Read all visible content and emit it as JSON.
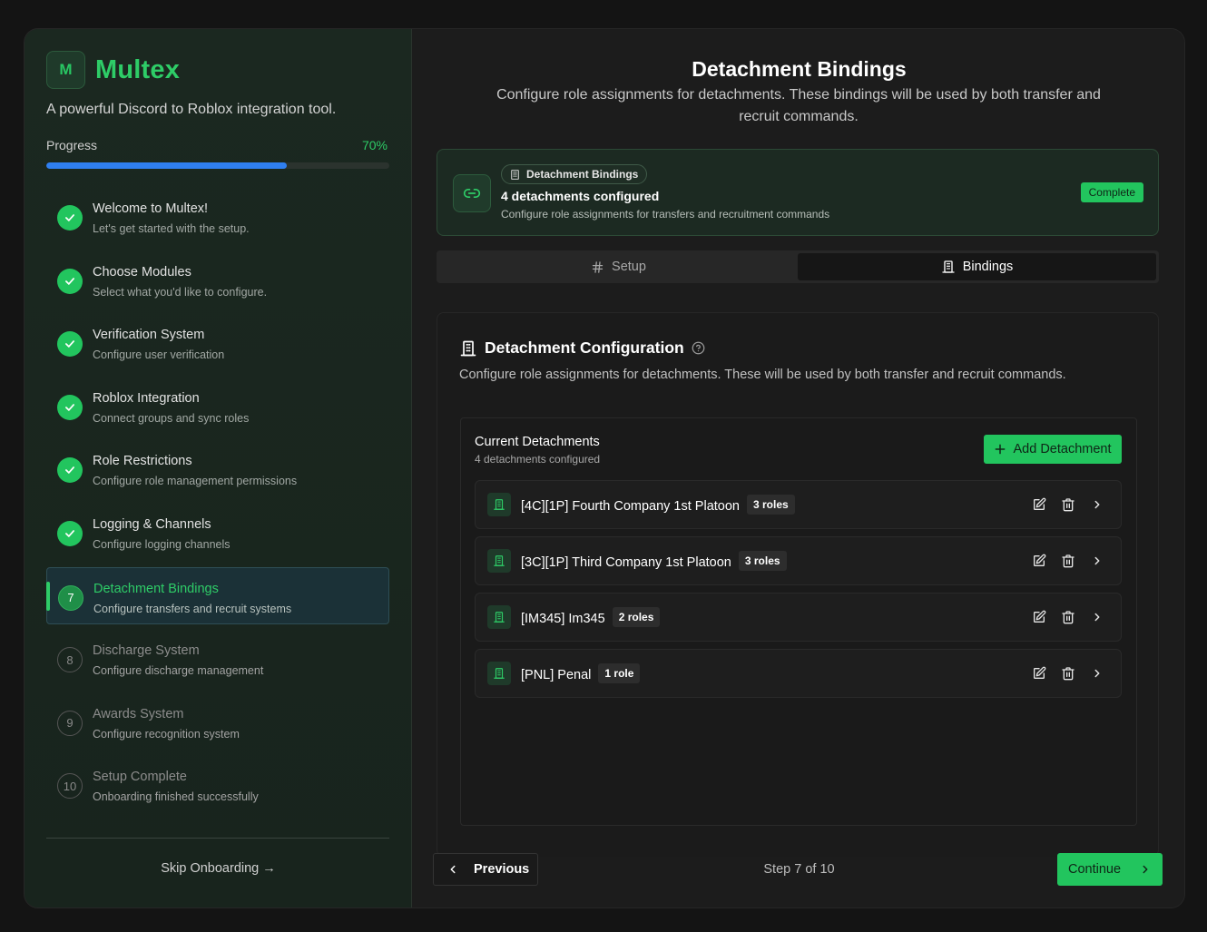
{
  "sidebar": {
    "logo_letter": "M",
    "brand": "Multex",
    "tagline": "A powerful Discord to Roblox integration tool.",
    "progress_label": "Progress",
    "progress_pct": "70%",
    "progress_value": 0.7,
    "steps": [
      {
        "title": "Welcome to Multex!",
        "sub": "Let's get started with the setup.",
        "state": "done",
        "num": "1"
      },
      {
        "title": "Choose Modules",
        "sub": "Select what you'd like to configure.",
        "state": "done",
        "num": "2"
      },
      {
        "title": "Verification System",
        "sub": "Configure user verification",
        "state": "done",
        "num": "3"
      },
      {
        "title": "Roblox Integration",
        "sub": "Connect groups and sync roles",
        "state": "done",
        "num": "4"
      },
      {
        "title": "Role Restrictions",
        "sub": "Configure role management permissions",
        "state": "done",
        "num": "5"
      },
      {
        "title": "Logging & Channels",
        "sub": "Configure logging channels",
        "state": "done",
        "num": "6"
      },
      {
        "title": "Detachment Bindings",
        "sub": "Configure transfers and recruit systems",
        "state": "current",
        "num": "7"
      },
      {
        "title": "Discharge System",
        "sub": "Configure discharge management",
        "state": "pending",
        "num": "8"
      },
      {
        "title": "Awards System",
        "sub": "Configure recognition system",
        "state": "pending",
        "num": "9"
      },
      {
        "title": "Setup Complete",
        "sub": "Onboarding finished successfully",
        "state": "pending",
        "num": "10"
      }
    ],
    "skip_label": "Skip Onboarding →"
  },
  "main": {
    "title": "Detachment Bindings",
    "description": "Configure role assignments for detachments. These bindings will be used by both transfer and recruit commands.",
    "status": {
      "chip": "Detachment Bindings",
      "title": "4 detachments configured",
      "sub": "Configure role assignments for transfers and recruitment commands",
      "badge": "Complete"
    },
    "tabs": [
      {
        "label": "Setup",
        "active": false
      },
      {
        "label": "Bindings",
        "active": true
      }
    ],
    "config": {
      "title": "Detachment Configuration",
      "description": "Configure role assignments for detachments. These will be used by both transfer and recruit commands.",
      "list_title": "Current Detachments",
      "list_sub": "4 detachments configured",
      "add_label": "Add Detachment",
      "rows": [
        {
          "name": "[4C][1P] Fourth Company 1st Platoon",
          "roles": "3 roles"
        },
        {
          "name": "[3C][1P] Third Company 1st Platoon",
          "roles": "3 roles"
        },
        {
          "name": "[IM345] Im345",
          "roles": "2 roles"
        },
        {
          "name": "[PNL] Penal",
          "roles": "1 role"
        }
      ]
    },
    "footer": {
      "prev_label": "Previous",
      "step_indicator": "Step 7 of 10",
      "next_label": "Continue"
    }
  },
  "colors": {
    "accent_green": "#22c55e",
    "progress_blue": "#2f7ff0",
    "background": "#141414"
  }
}
